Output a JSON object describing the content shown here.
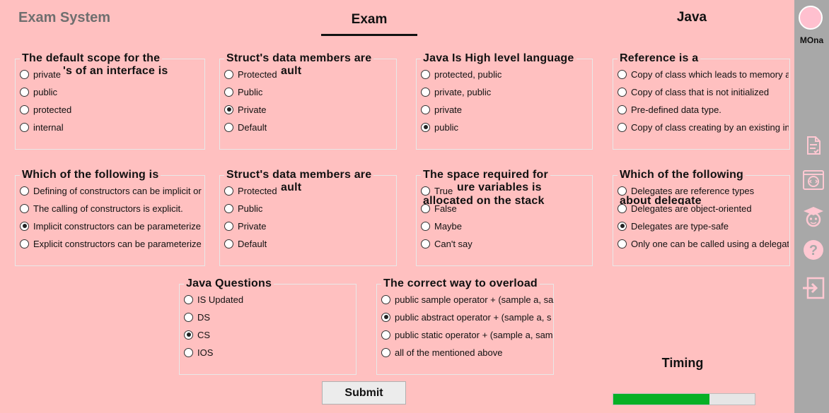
{
  "app_title": "Exam System",
  "tab": "Exam",
  "subject": "Java",
  "user": {
    "name": "MOna"
  },
  "sidebar_icons": [
    "exam-list-icon",
    "code-icon",
    "student-icon",
    "help-icon",
    "logout-icon"
  ],
  "questions": [
    {
      "title": "The default scope for the",
      "title_line2": "'s of an interface is",
      "options": [
        {
          "label": "private",
          "selected": false
        },
        {
          "label": "public",
          "selected": false
        },
        {
          "label": "protected",
          "selected": false
        },
        {
          "label": "internal",
          "selected": false
        }
      ]
    },
    {
      "title": "Struct's data members are",
      "title_line2": "ault",
      "options": [
        {
          "label": "Protected",
          "selected": false
        },
        {
          "label": "Public",
          "selected": false
        },
        {
          "label": "Private",
          "selected": true
        },
        {
          "label": "Default",
          "selected": false
        }
      ]
    },
    {
      "title": "Java Is High level language",
      "options": [
        {
          "label": "protected, public",
          "selected": false
        },
        {
          "label": "private, public",
          "selected": false
        },
        {
          "label": "private",
          "selected": false
        },
        {
          "label": "public",
          "selected": true
        }
      ]
    },
    {
      "title": "Reference is a",
      "options": [
        {
          "label": "Copy of class which leads to memory a",
          "selected": false
        },
        {
          "label": "Copy of class that is not initialized",
          "selected": false
        },
        {
          "label": "Pre-defined data type.",
          "selected": false
        },
        {
          "label": "Copy of class creating by an existing in",
          "selected": false
        }
      ]
    },
    {
      "title": "Which of the following is",
      "options": [
        {
          "label": "Defining of constructors can be implicit or",
          "selected": false
        },
        {
          "label": "The calling of constructors is explicit.",
          "selected": false
        },
        {
          "label": "Implicit constructors can be parameterize",
          "selected": true
        },
        {
          "label": "Explicit constructors can be parameterize",
          "selected": false
        }
      ]
    },
    {
      "title": "Struct's data members are",
      "title_line2": "ault",
      "options": [
        {
          "label": "Protected",
          "selected": false
        },
        {
          "label": "Public",
          "selected": false
        },
        {
          "label": "Private",
          "selected": false
        },
        {
          "label": "Default",
          "selected": false
        }
      ]
    },
    {
      "title": "The space required for",
      "title_line2": "ure variables is",
      "title_line3": "allocated on the stack",
      "options": [
        {
          "label": "True",
          "selected": false
        },
        {
          "label": "False",
          "selected": false
        },
        {
          "label": "Maybe",
          "selected": false
        },
        {
          "label": "Can't say",
          "selected": false
        }
      ]
    },
    {
      "title": "Which of the following",
      "title_line2": "about delegate",
      "options": [
        {
          "label": "Delegates are reference types",
          "selected": false
        },
        {
          "label": "Delegates are object-oriented",
          "selected": false
        },
        {
          "label": "Delegates are type-safe",
          "selected": true
        },
        {
          "label": "Only one can be called using a delegate",
          "selected": false
        }
      ]
    },
    {
      "title": "Java Questions",
      "options": [
        {
          "label": "IS  Updated",
          "selected": false
        },
        {
          "label": "DS",
          "selected": false
        },
        {
          "label": "CS",
          "selected": true
        },
        {
          "label": "IOS",
          "selected": false
        }
      ]
    },
    {
      "title": "The correct way to overload",
      "options": [
        {
          "label": "public sample operator +  (sample a, sa",
          "selected": false
        },
        {
          "label": "public abstract operator +  (sample a, s",
          "selected": true
        },
        {
          "label": "public static operator +  (sample a, sam",
          "selected": false
        },
        {
          "label": "all of the mentioned above",
          "selected": false
        }
      ]
    }
  ],
  "submit_label": "Submit",
  "timing_label": "Timing",
  "timing_progress": 0.68,
  "colors": {
    "background": "#ffc0c0",
    "sidebar": "#a8a8a8",
    "progress": "#06b025"
  }
}
